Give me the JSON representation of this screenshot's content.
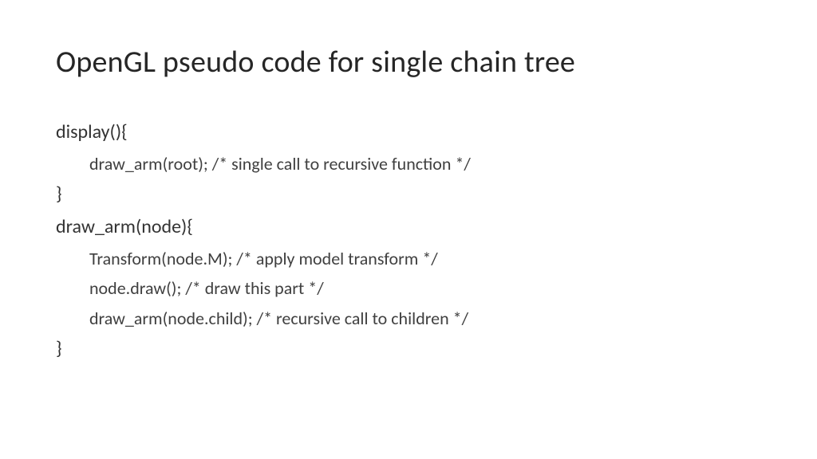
{
  "title": "OpenGL pseudo code for single chain tree",
  "code": {
    "l1": "display(){",
    "l2": "draw_arm(root); /* single call to recursive function */",
    "l3": "}",
    "l4": "draw_arm(node){",
    "l5": "Transform(node.M); /* apply model transform */",
    "l6": "node.draw(); /* draw this part */",
    "l7": "draw_arm(node.child); /* recursive call to children */",
    "l8": "}"
  }
}
